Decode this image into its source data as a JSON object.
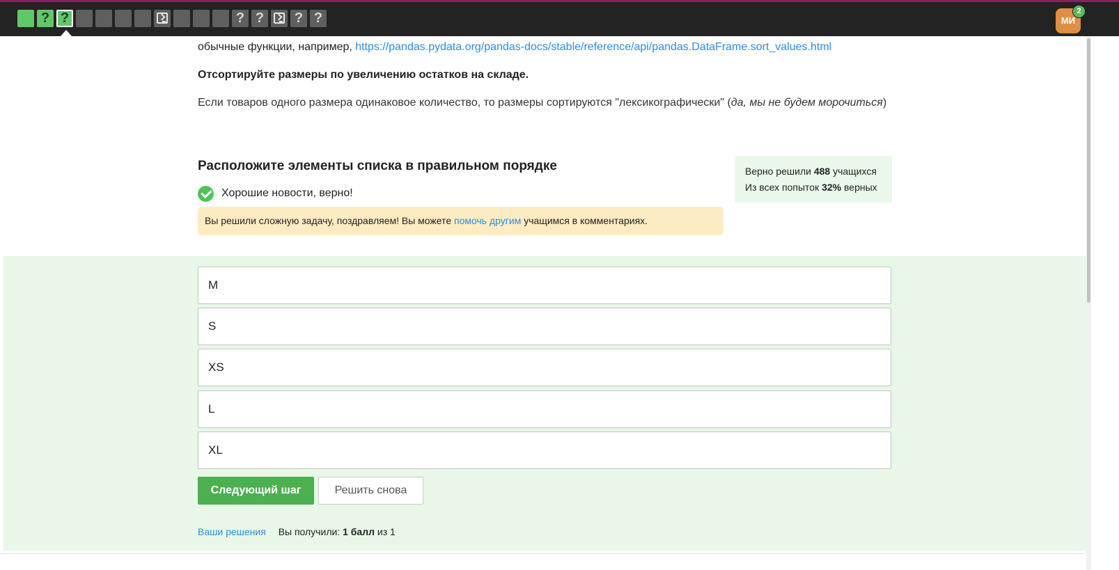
{
  "topbar": {
    "steps": [
      {
        "type": "green",
        "glyph": ""
      },
      {
        "type": "green",
        "glyph": "?"
      },
      {
        "type": "green-current",
        "glyph": "?"
      },
      {
        "type": "grey",
        "glyph": ""
      },
      {
        "type": "grey",
        "glyph": ""
      },
      {
        "type": "grey",
        "glyph": ""
      },
      {
        "type": "grey",
        "glyph": ""
      },
      {
        "type": "terminal",
        "glyph": ""
      },
      {
        "type": "grey",
        "glyph": ""
      },
      {
        "type": "grey",
        "glyph": ""
      },
      {
        "type": "grey",
        "glyph": ""
      },
      {
        "type": "grey",
        "glyph": "?"
      },
      {
        "type": "grey",
        "glyph": "?"
      },
      {
        "type": "terminal",
        "glyph": ""
      },
      {
        "type": "grey",
        "glyph": "?"
      },
      {
        "type": "grey",
        "glyph": "?"
      }
    ],
    "avatar_initials": "МИ",
    "notification_count": "2"
  },
  "task": {
    "intro_text": "обычные функции, например, ",
    "link": "https://pandas.pydata.org/pandas-docs/stable/reference/api/pandas.DataFrame.sort_values.html",
    "instruction": "Отсортируйте размеры по увеличению остатков на складе.",
    "rule_prefix": "Если товаров одного размера одинаковое количество, то размеры сортируются \"лексикографически\" (",
    "rule_italic": "да, мы не будем морочиться",
    "rule_suffix": ")"
  },
  "question": {
    "heading": "Расположите элементы списка в правильном порядке",
    "result_text": "Хорошие новости, верно!",
    "notice_prefix": "Вы решили сложную задачу, поздравляем! Вы можете ",
    "notice_link": "помочь другим",
    "notice_suffix": " учащимся в комментариях."
  },
  "stats": {
    "solved_prefix": "Верно решили ",
    "solved_count": "488",
    "solved_suffix": " учащихся",
    "attempts_prefix": "Из всех попыток ",
    "attempts_percent": "32%",
    "attempts_suffix": " верных"
  },
  "items": [
    "M",
    "S",
    "XS",
    "L",
    "XL"
  ],
  "actions": {
    "next_label": "Следующий шаг",
    "retry_label": "Решить снова"
  },
  "footer": {
    "solutions_link": "Ваши решения",
    "score_prefix": "Вы получили: ",
    "score_value": "1 балл",
    "score_suffix": " из 1"
  },
  "colors": {
    "topbar_bg": "#232323",
    "step_green": "#5fc867",
    "step_grey": "#5f5f5f",
    "accent_green": "#4caf50",
    "answer_bg": "#e8f7e8",
    "notice_bg": "#fdebc2",
    "link": "#2c8bde",
    "avatar": "#dd8f45"
  }
}
